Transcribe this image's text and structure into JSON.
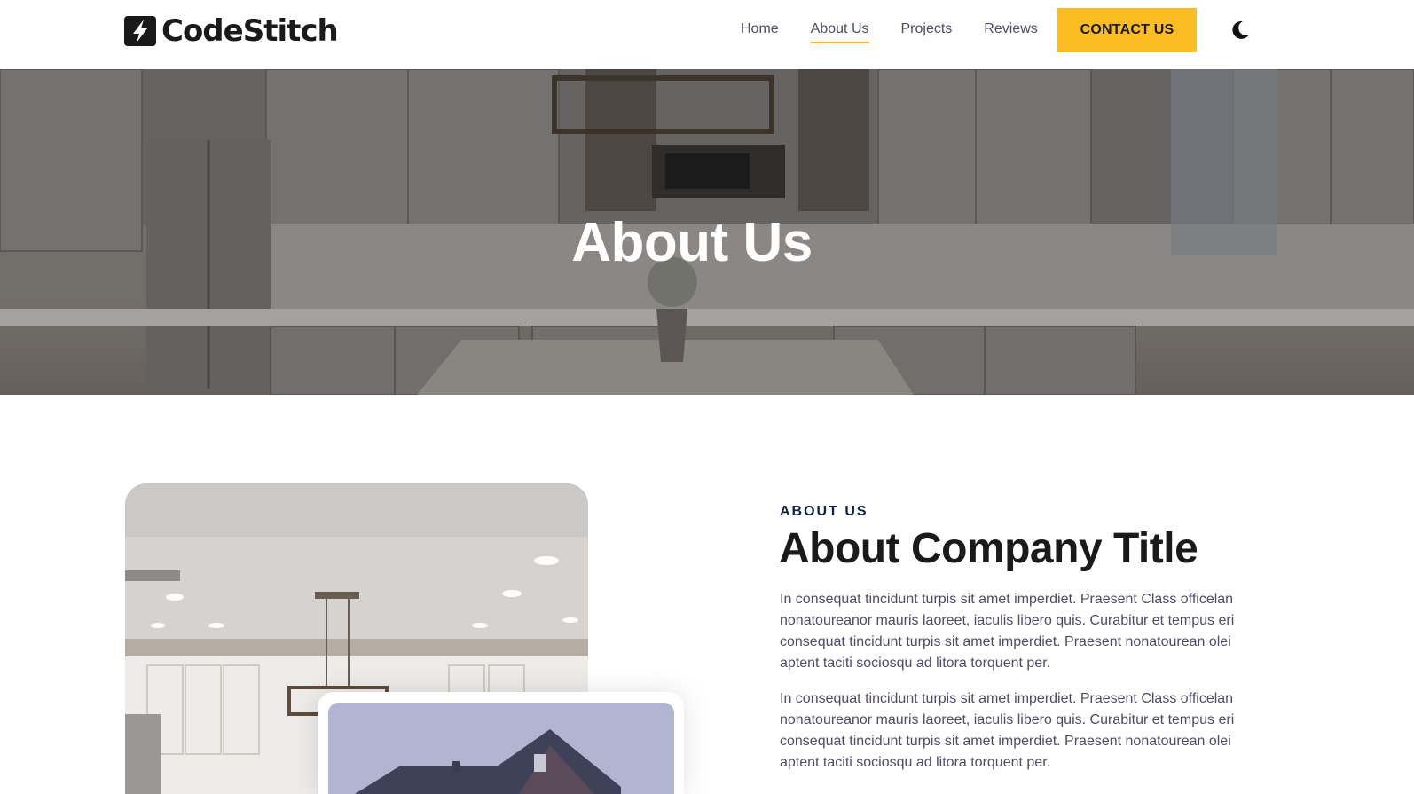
{
  "header": {
    "logo_text": "CodeStitch",
    "nav": {
      "home": "Home",
      "about": "About Us",
      "projects": "Projects",
      "reviews": "Reviews"
    },
    "contact_label": "CONTACT US",
    "accent_color": "#fbbd23"
  },
  "hero": {
    "title": "About Us"
  },
  "about": {
    "topper": "ABOUT US",
    "title": "About Company Title",
    "paragraphs": [
      "In consequat tincidunt turpis sit amet imperdiet. Praesent Class officelan nonatoureanor mauris laoreet, iaculis libero quis. Curabitur et tempus eri consequat tincidunt turpis sit amet imperdiet. Praesent nonatourean olei aptent taciti sociosqu ad litora torquent per.",
      "In consequat tincidunt turpis sit amet imperdiet. Praesent Class officelan nonatoureanor mauris laoreet, iaculis libero quis. Curabitur et tempus eri consequat tincidunt turpis sit amet imperdiet. Praesent nonatourean olei aptent taciti sociosqu ad litora torquent per."
    ]
  },
  "icons": {
    "logo": "codestitch-logo-icon",
    "theme": "moon-icon"
  }
}
